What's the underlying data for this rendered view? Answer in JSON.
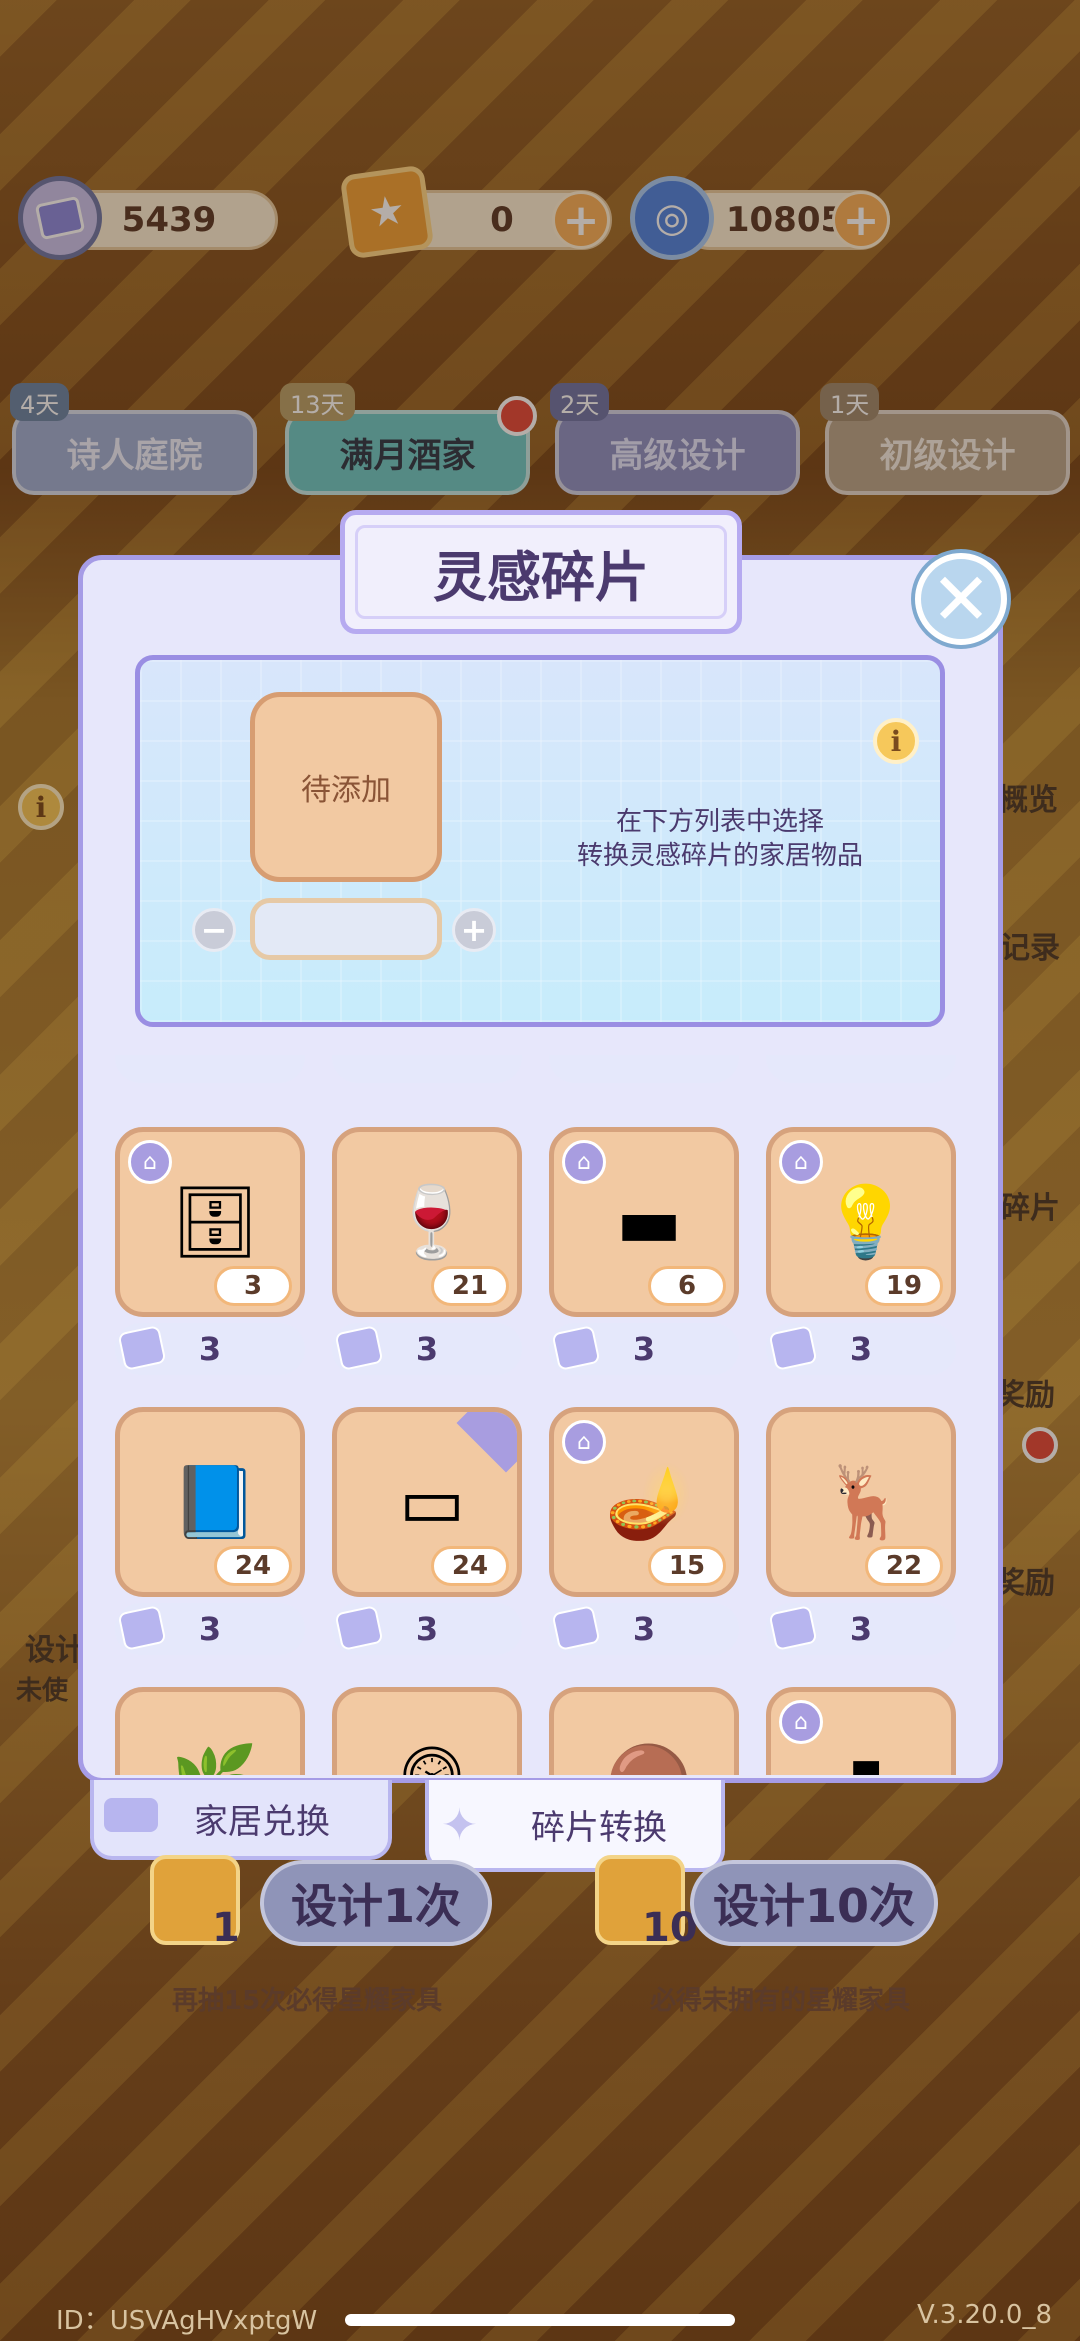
{
  "currency": {
    "fragments": "5439",
    "tickets": "0",
    "crystals": "10805"
  },
  "banners": [
    {
      "days": "4天",
      "label": "诗人庭院"
    },
    {
      "days": "13天",
      "label": "满月酒家"
    },
    {
      "days": "2天",
      "label": "高级设计"
    },
    {
      "days": "1天",
      "label": "初级设计"
    }
  ],
  "side": {
    "overview": "概览",
    "record": "记录",
    "fragments": "碎片",
    "reward1": "奖励",
    "reward2": "奖励",
    "design": "设计",
    "unused": "未使"
  },
  "modal": {
    "title": "灵感碎片",
    "slot_label": "待添加",
    "hint_line1": "在下方列表中选择",
    "hint_line2": "转换灵感碎片的家居物品"
  },
  "items": [
    {
      "count": "3",
      "price": "3",
      "icon": "cabinet-icon",
      "glyph": "🗄",
      "tag": true
    },
    {
      "count": "21",
      "price": "3",
      "icon": "wine-bottle-icon",
      "glyph": "🍷",
      "tag": false
    },
    {
      "count": "6",
      "price": "3",
      "icon": "wall-shelf-icon",
      "glyph": "▬",
      "tag": true
    },
    {
      "count": "19",
      "price": "3",
      "icon": "floor-lamp-icon",
      "glyph": "💡",
      "tag": true
    },
    {
      "count": "24",
      "price": "3",
      "icon": "book-quill-icon",
      "glyph": "📘",
      "tag": false
    },
    {
      "count": "24",
      "price": "3",
      "icon": "floor-strip-icon",
      "glyph": "▭",
      "tag": false
    },
    {
      "count": "15",
      "price": "3",
      "icon": "standing-lamp-icon",
      "glyph": "🪔",
      "tag": true
    },
    {
      "count": "22",
      "price": "3",
      "icon": "deer-head-icon",
      "glyph": "🦌",
      "tag": false
    },
    {
      "count": "",
      "price": "",
      "icon": "plant-icon",
      "glyph": "🌿",
      "tag": false
    },
    {
      "count": "",
      "price": "",
      "icon": "clock-icon",
      "glyph": "🕰",
      "tag": false
    },
    {
      "count": "",
      "price": "",
      "icon": "rug-icon",
      "glyph": "🟤",
      "tag": false
    },
    {
      "count": "",
      "price": "",
      "icon": "green-panel-icon",
      "glyph": "▮",
      "tag": true
    }
  ],
  "tabs": {
    "home_exchange": "家居兑换",
    "fragment_convert": "碎片转换"
  },
  "design": {
    "once_label": "设计1次",
    "once_count": "1",
    "once_note": "再抽15次必得星耀家具",
    "ten_label": "设计10次",
    "ten_count": "10",
    "ten_note": "必得未拥有的星耀家具"
  },
  "footer": {
    "id": "ID：USVAgHVxptgW",
    "version": "V.3.20.0_8"
  },
  "colors": {
    "accent": "#a69ce6",
    "card": "#f2c9a2",
    "title": "#4b3a6e"
  }
}
